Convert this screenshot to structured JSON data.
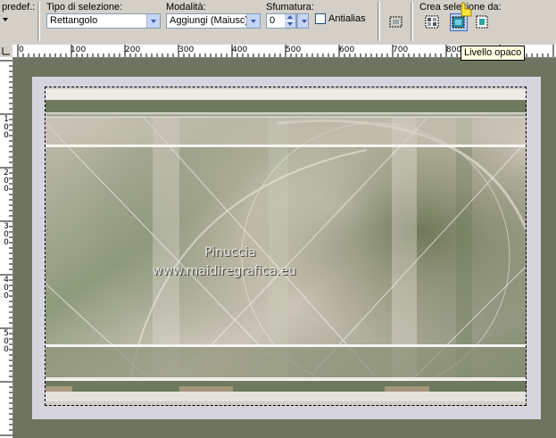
{
  "toolbar": {
    "preset_label": "predef.:",
    "selection_type_label": "Tipo di selezione:",
    "selection_type_value": "Rettangolo",
    "mode_label": "Modalità:",
    "mode_value": "Aggiungi (Maiusc)",
    "feather_label": "Sfumatura:",
    "feather_value": "0",
    "antialias_label": "Antialias",
    "create_selection_label": "Crea selezione da:"
  },
  "tooltip": {
    "text": "Livello opaco"
  },
  "ruler": {
    "horizontal": [
      "0",
      "100",
      "200",
      "300",
      "400",
      "500",
      "600",
      "700",
      "800"
    ],
    "vertical": [
      "100",
      "200",
      "300",
      "400",
      "500"
    ]
  },
  "image": {
    "watermark_line1": "Pinuccia",
    "watermark_line2": "www.maidiregrafica.eu"
  },
  "colors": {
    "workspace": "#6d7560",
    "canvas_border": "#d6d5de",
    "toolbar": "#d4d0c8",
    "accent": "#316ac5"
  },
  "icons": [
    "dropdown-arrow-icon",
    "select-all-icon",
    "create-from-mask-icon",
    "opaque-layer-icon",
    "create-from-transparent-icon",
    "cursor-hand-icon"
  ]
}
